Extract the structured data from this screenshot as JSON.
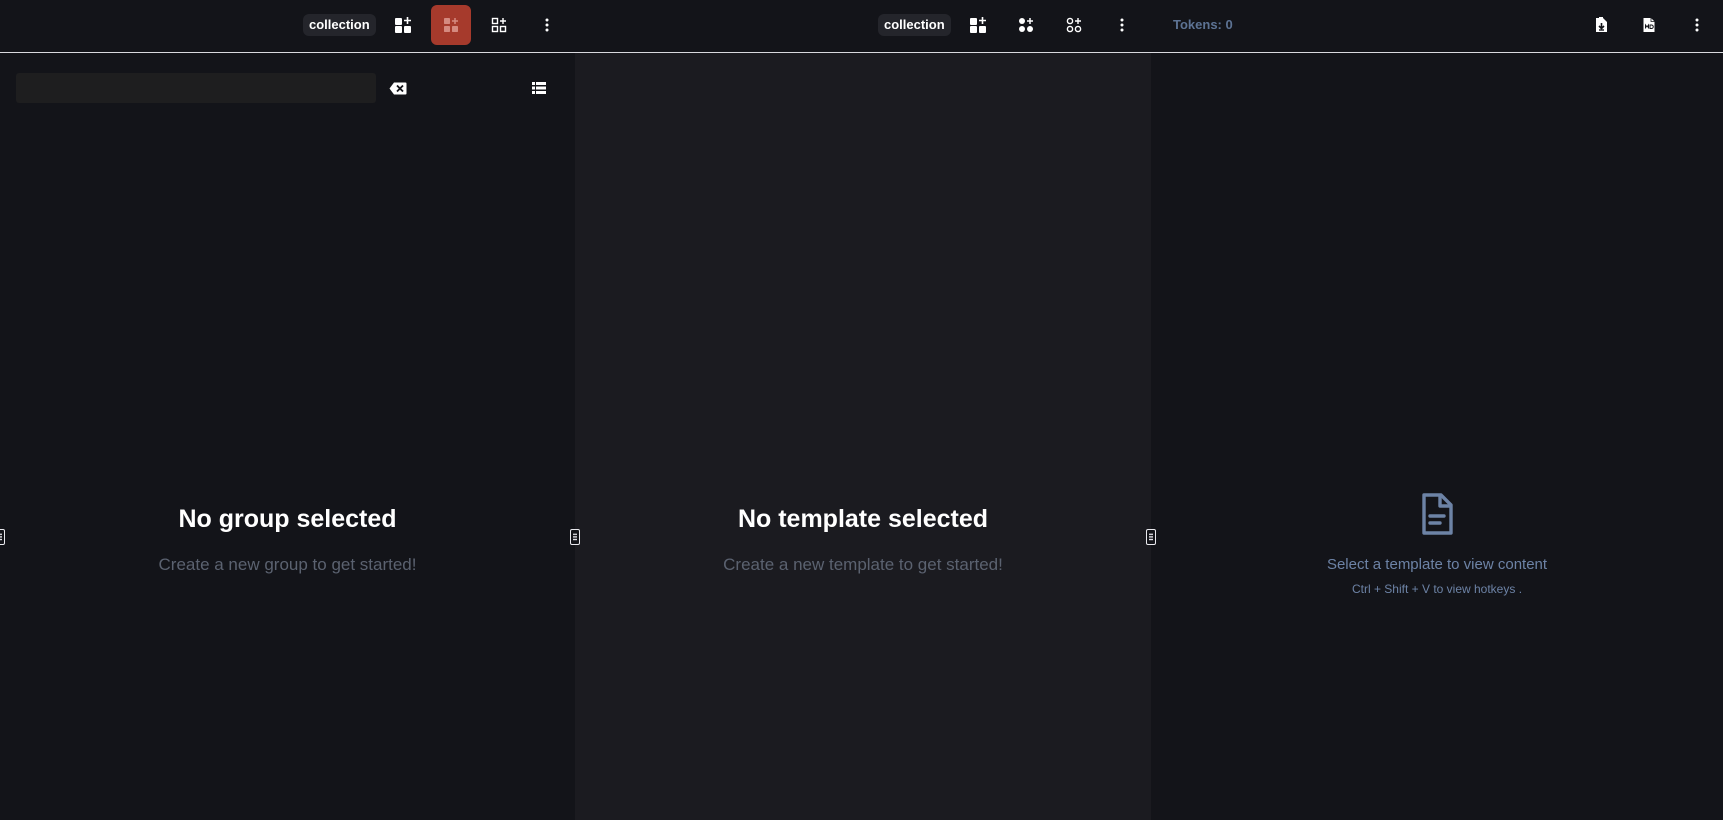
{
  "left": {
    "toolbar": {
      "collection_label": "collection",
      "icons": [
        "add-widget-icon",
        "add-group-icon",
        "grid-add-icon",
        "more-vert-icon"
      ]
    },
    "search": {
      "placeholder": "",
      "value": ""
    },
    "empty": {
      "title": "No group selected",
      "subtitle": "Create a new group to get started!"
    }
  },
  "middle": {
    "toolbar": {
      "collection_label": "collection",
      "icons": [
        "add-widget-icon",
        "add-circles-icon",
        "add-outlined-circles-icon",
        "more-vert-icon"
      ]
    },
    "empty": {
      "title": "No template selected",
      "subtitle": "Create a new template to get started!"
    }
  },
  "right": {
    "toolbar": {
      "tokens_label": "Tokens: 0",
      "icons": [
        "download-file-icon",
        "md-file-icon",
        "more-vert-icon"
      ]
    },
    "empty": {
      "text": "Select a template to view content",
      "hint": "Ctrl + Shift + V to view hotkeys ."
    }
  },
  "colors": {
    "accent": "#a63a2c",
    "bg_dark": "#131419",
    "bg_mid": "#1b1b20",
    "muted_text": "#5b6270",
    "blue_text": "#6d83a6"
  }
}
